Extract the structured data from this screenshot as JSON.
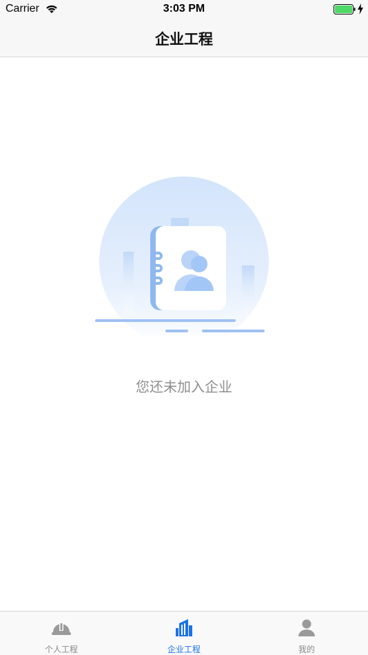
{
  "status_bar": {
    "carrier": "Carrier",
    "time": "3:03 PM"
  },
  "nav": {
    "title": "企业工程"
  },
  "empty_state": {
    "message": "您还未加入企业",
    "illustration_icon": "contacts-book-icon"
  },
  "tab_bar": {
    "tabs": [
      {
        "label": "个人工程",
        "icon": "hard-hat-icon",
        "active": false
      },
      {
        "label": "企业工程",
        "icon": "building-icon",
        "active": true
      },
      {
        "label": "我的",
        "icon": "person-icon",
        "active": false
      }
    ]
  },
  "colors": {
    "accent": "#1a73e8",
    "inactive": "#8a8a8a",
    "battery": "#4cd964",
    "illustration_light": "#dbe9fb",
    "illustration_mid": "#8fb8ef"
  }
}
